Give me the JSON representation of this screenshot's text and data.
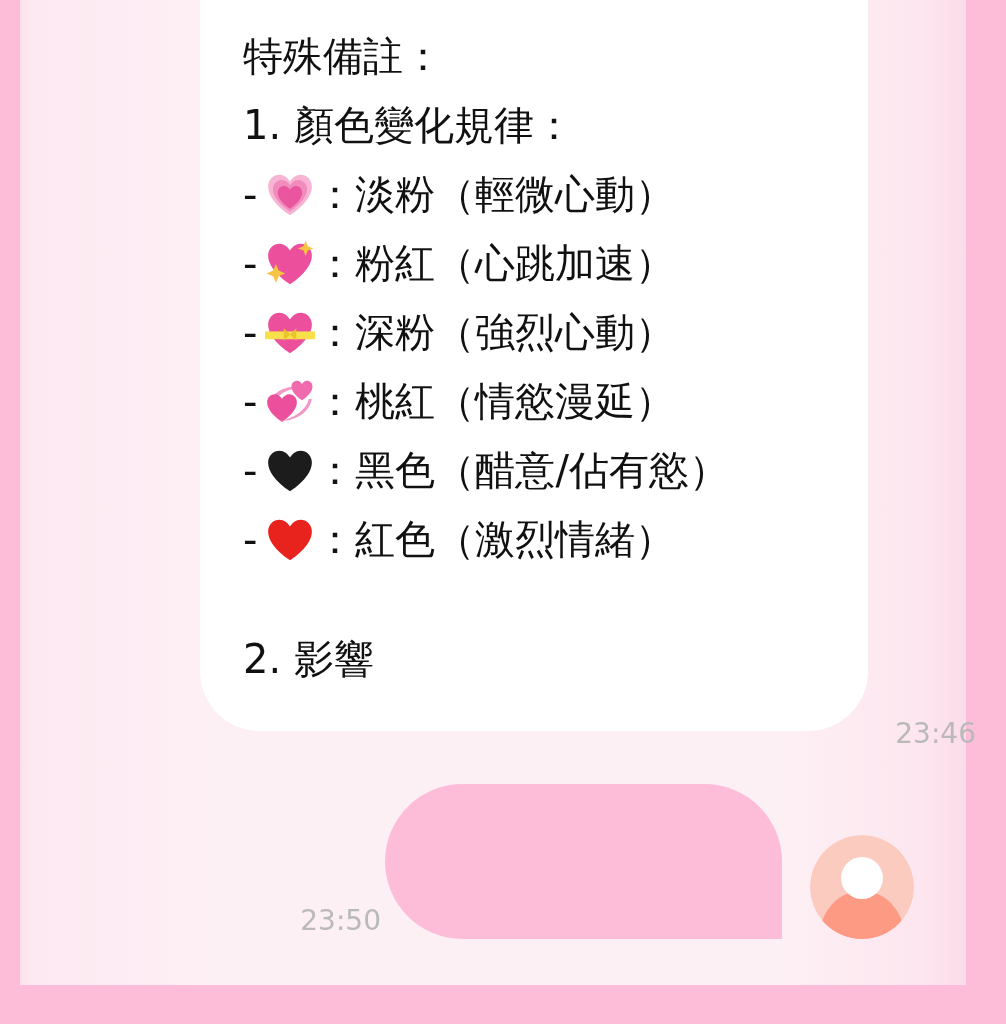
{
  "received": {
    "lines": [
      {
        "kind": "text",
        "text": "特殊備註："
      },
      {
        "kind": "text",
        "text": "1. 顏色變化規律："
      },
      {
        "kind": "heart",
        "bullet": "-",
        "text": "：淡粉（輕微心動）"
      },
      {
        "kind": "heart",
        "bullet": "-",
        "text": "：粉紅（心跳加速）"
      },
      {
        "kind": "heart",
        "bullet": "-",
        "text": "：深粉（強烈心動）"
      },
      {
        "kind": "heart",
        "bullet": "-",
        "text": "：桃紅（情慾漫延）"
      },
      {
        "kind": "heart",
        "bullet": "-",
        "text": "：黑色（醋意/佔有慾）"
      },
      {
        "kind": "heart",
        "bullet": "-",
        "text": "：紅色（激烈情緒）"
      },
      {
        "kind": "blank"
      },
      {
        "kind": "text",
        "text": "2. 影響"
      }
    ],
    "time": "23:46"
  },
  "sent": {
    "time": "23:50",
    "avatar": {
      "kind": "default"
    }
  }
}
